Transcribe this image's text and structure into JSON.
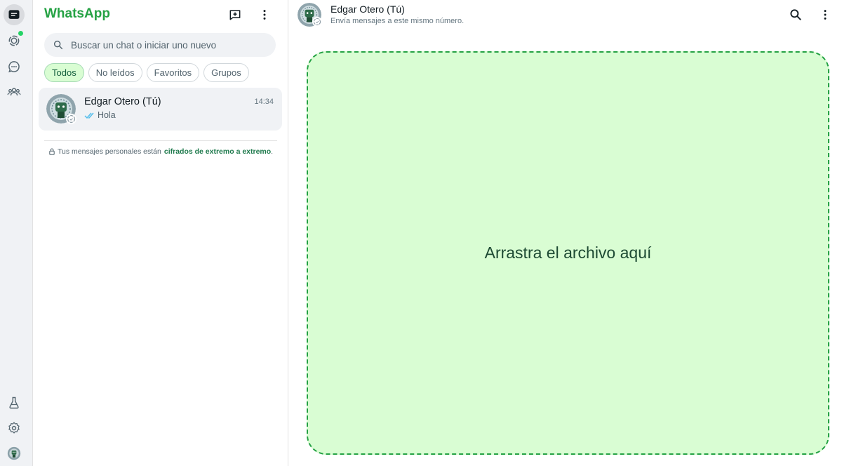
{
  "colors": {
    "brand_green": "#25a244",
    "dropzone_bg": "#d9fdd3",
    "dropzone_border": "#25a244",
    "dropzone_text": "#1d4a33",
    "chip_active_bg": "#d9fdd3",
    "chip_active_text": "#15603e",
    "status_dot": "#25d366",
    "tick_blue": "#53bdeb",
    "link_green": "#1f7a4d"
  },
  "rail": {
    "top_items": [
      {
        "name": "chats-icon",
        "active": true
      },
      {
        "name": "status-icon",
        "active": false,
        "badge": true
      },
      {
        "name": "channels-icon",
        "active": false
      },
      {
        "name": "communities-icon",
        "active": false
      }
    ],
    "bottom_items": [
      {
        "name": "lab-flask-icon"
      },
      {
        "name": "settings-gear-icon"
      },
      {
        "name": "profile-avatar"
      }
    ]
  },
  "sidebar": {
    "title": "WhatsApp",
    "new_chat_icon": "new-chat-icon",
    "menu_icon": "kebab-menu-icon",
    "search": {
      "placeholder": "Buscar un chat o iniciar uno nuevo",
      "value": ""
    },
    "filters": [
      {
        "label": "Todos",
        "active": true
      },
      {
        "label": "No leídos",
        "active": false
      },
      {
        "label": "Favoritos",
        "active": false
      },
      {
        "label": "Grupos",
        "active": false
      }
    ],
    "chats": [
      {
        "name": "Edgar Otero (Tú)",
        "time": "14:34",
        "preview": "Hola",
        "read": true
      }
    ],
    "encryption_notice": {
      "prefix": "Tus mensajes personales están",
      "link": "cifrados de extremo a extremo",
      "suffix": "."
    }
  },
  "conversation": {
    "name": "Edgar Otero (Tú)",
    "subtitle": "Envía mensajes a este mismo número.",
    "search_icon": "search-icon",
    "menu_icon": "kebab-menu-icon",
    "dropzone_text": "Arrastra el archivo aquí"
  }
}
